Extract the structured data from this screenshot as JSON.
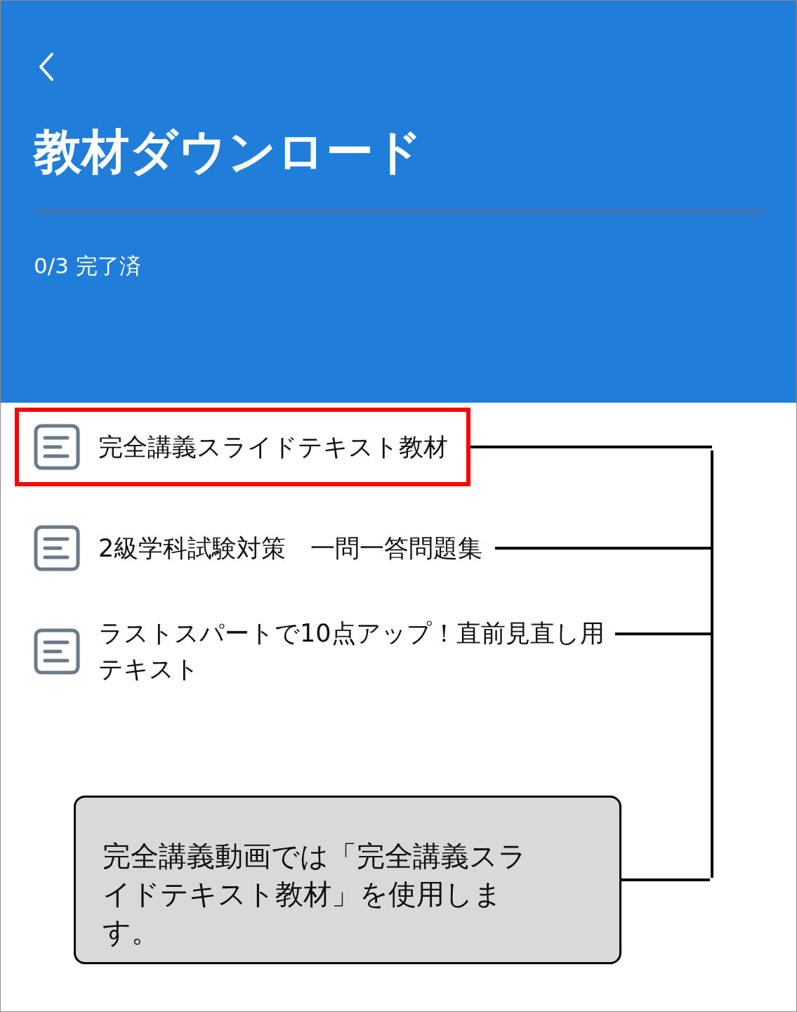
{
  "header": {
    "title": "教材ダウンロード",
    "progress": {
      "level": 0
    },
    "status": "0/3 完了済"
  },
  "materials": [
    {
      "title": "完全講義スライドテキスト教材",
      "highlighted": true
    },
    {
      "title": "2級学科試験対策　一問一答問題集",
      "highlighted": false
    },
    {
      "title": "ラストスパートで10点アップ！直前見直し用テキスト",
      "highlighted": false
    }
  ],
  "callout": {
    "text": "完全講義動画では「完全講義スライドテキスト教材」を使用します。"
  }
}
